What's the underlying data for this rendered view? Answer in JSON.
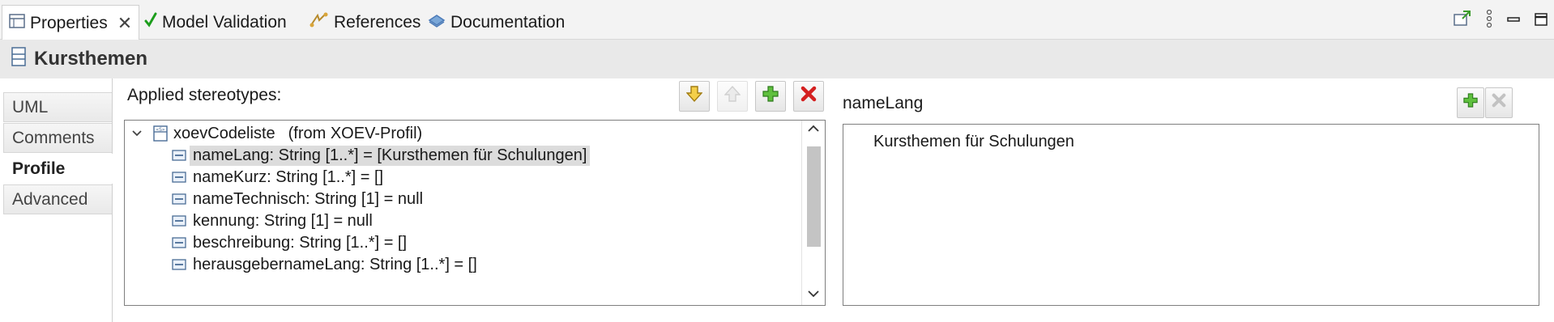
{
  "tabs": [
    {
      "label": "Properties",
      "icon": "properties-icon",
      "active": true,
      "closable": true
    },
    {
      "label": "Model Validation",
      "icon": "checkmark-icon"
    },
    {
      "label": "References",
      "icon": "references-icon"
    },
    {
      "label": "Documentation",
      "icon": "documentation-icon"
    }
  ],
  "close_glyph": "✕",
  "element": {
    "title": "Kursthemen",
    "icon": "class-icon"
  },
  "sections": [
    "UML",
    "Comments",
    "Profile",
    "Advanced"
  ],
  "active_section": "Profile",
  "stereotypes": {
    "label": "Applied stereotypes:",
    "tree": {
      "root": {
        "name": "xoevCodeliste",
        "from": "(from XOEV-Profil)",
        "expanded": true
      },
      "rows": [
        "nameLang: String [1..*] = [Kursthemen für Schulungen]",
        "nameKurz: String [1..*] = []",
        "nameTechnisch: String [1] = null",
        "kennung: String [1] = null",
        "beschreibung: String [1..*] = []",
        "herausgebernameLang: String [1..*] = []"
      ],
      "selected_index": 0
    }
  },
  "detail": {
    "label": "nameLang",
    "value": "Kursthemen für Schulungen"
  },
  "colors": {
    "add_green": "#3a9a2a",
    "delete_red": "#d42020",
    "check_green": "#1c9d1c",
    "doc_blue": "#4a7ab8"
  }
}
